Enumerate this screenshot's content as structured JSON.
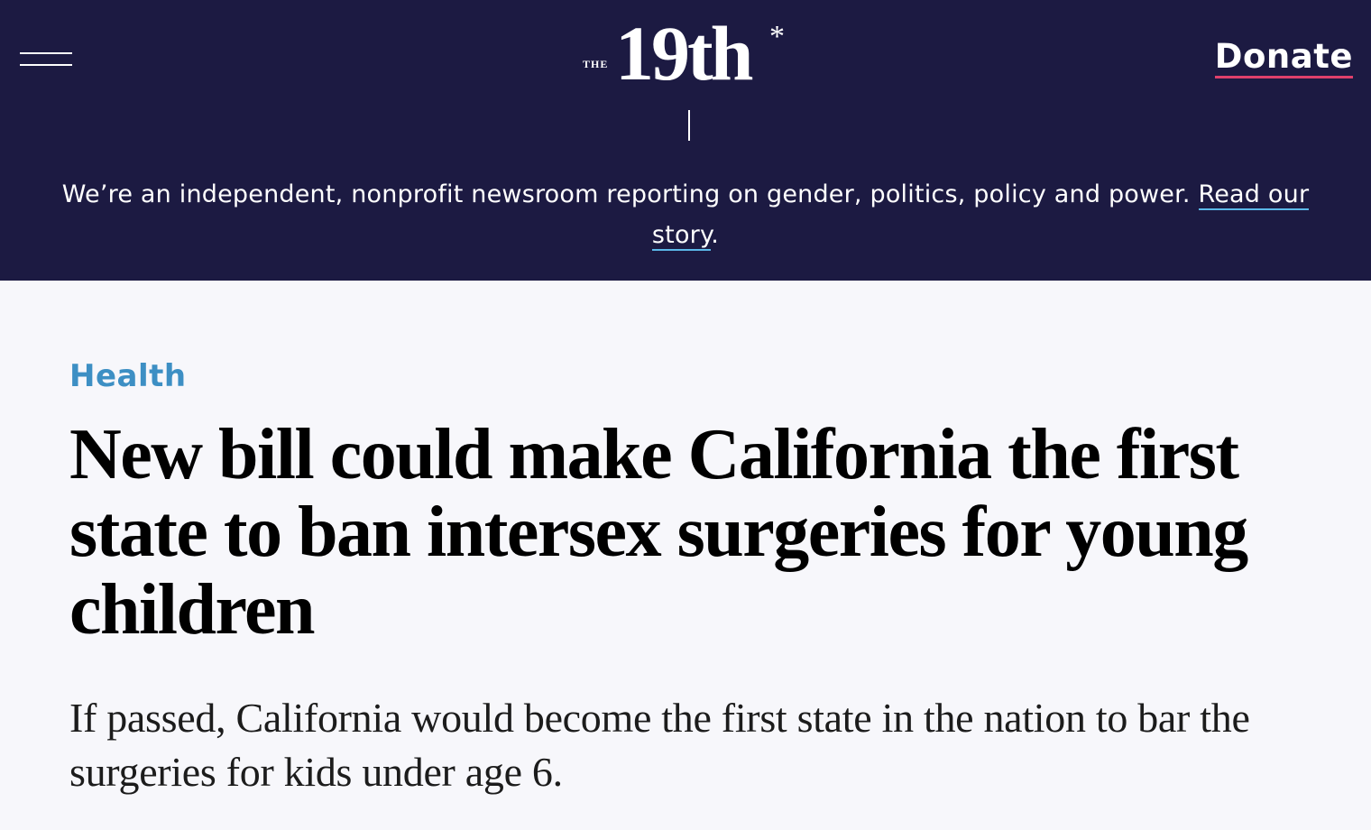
{
  "header": {
    "menu_icon": "hamburger-menu-icon",
    "logo": {
      "prefix": "THE",
      "name": "19th",
      "mark": "*"
    },
    "donate_label": "Donate",
    "tagline": {
      "text": "We’re an independent, nonprofit newsroom reporting on gender, politics, policy and power. ",
      "link_text": "Read our story",
      "suffix": "."
    },
    "colors": {
      "background": "#1c1a42",
      "donate_underline": "#e0406b",
      "link_underline": "#5bb8e8"
    }
  },
  "article": {
    "category": "Health",
    "headline": "New bill could make California the first state to ban intersex surgeries for young children",
    "dek": "If passed, California would become the first state in the nation to bar the surgeries for kids under age 6.",
    "colors": {
      "category": "#3d8fc4",
      "page_background": "#f7f7fb"
    }
  }
}
